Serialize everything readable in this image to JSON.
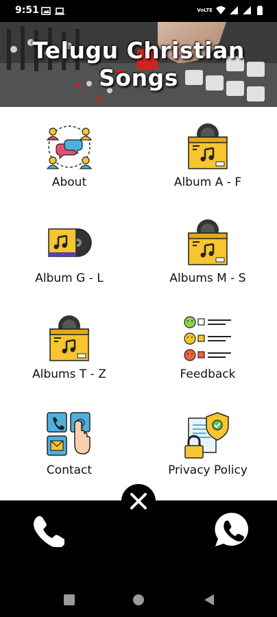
{
  "status_bar": {
    "time": "9:51",
    "icons": [
      "gallery-icon",
      "laptop-icon",
      "volte-icon",
      "wifi-icon",
      "signal-icon",
      "signal-icon",
      "battery-icon"
    ],
    "volte_text": "VoLTE"
  },
  "header": {
    "title_line1": "Telugu Christian",
    "title_line2": "Songs"
  },
  "menu": {
    "items": [
      {
        "label": "About",
        "icon": "people-chat-icon"
      },
      {
        "label": "Album A - F",
        "icon": "music-box-icon"
      },
      {
        "label": "Album G - L",
        "icon": "album-record-icon"
      },
      {
        "label": "Albums M - S",
        "icon": "music-box-icon"
      },
      {
        "label": "Albums T - Z",
        "icon": "music-box-icon"
      },
      {
        "label": "Feedback",
        "icon": "feedback-emoji-icon"
      },
      {
        "label": "Contact",
        "icon": "contact-icon"
      },
      {
        "label": "Privacy Policy",
        "icon": "privacy-lock-icon"
      }
    ]
  },
  "colors": {
    "accent_yellow": "#F6C52F",
    "background": "#FFFFFF",
    "bar": "#000000"
  },
  "bottom_bar": {
    "left_icon": "phone-icon",
    "right_icon": "whatsapp-icon",
    "center_icon": "close-icon"
  },
  "nav_bar": {
    "buttons": [
      "recents-icon",
      "home-icon",
      "back-icon"
    ]
  }
}
